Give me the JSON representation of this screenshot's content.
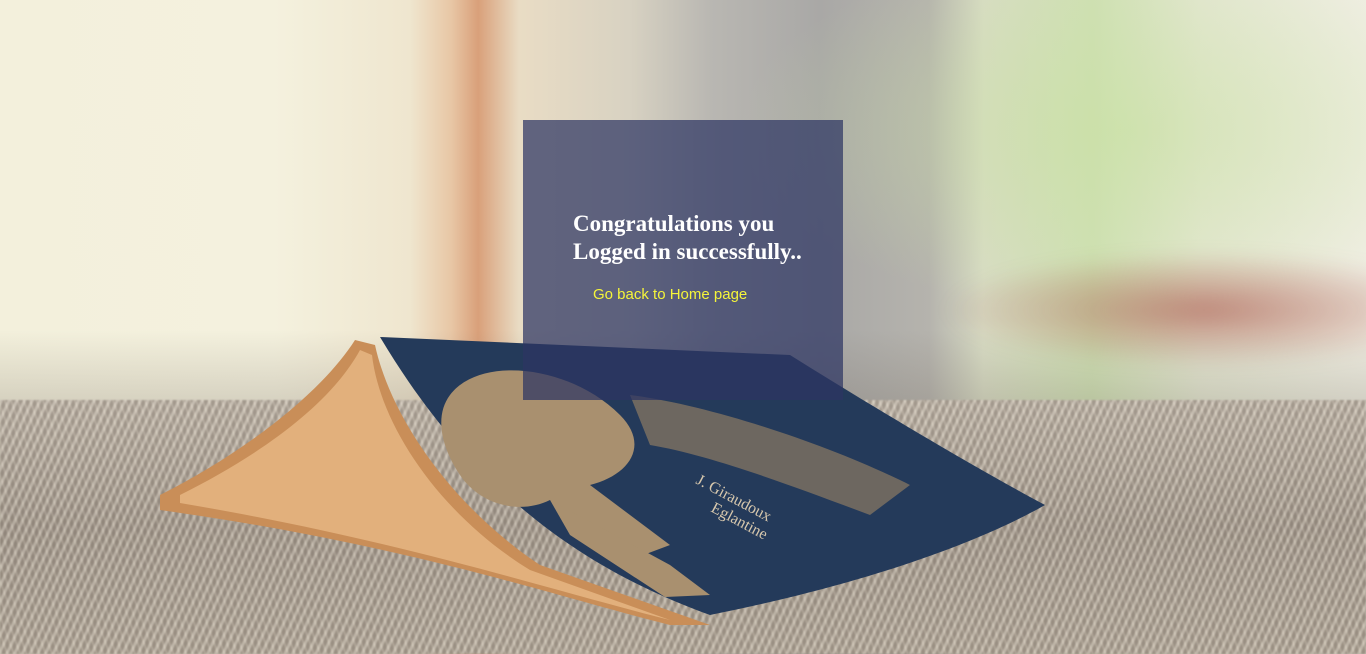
{
  "message": {
    "title": "Congratulations you Logged in successfully..",
    "link_label": "Go back to Home page"
  },
  "background": {
    "book_cover_text_line1": "J. Giraudoux",
    "book_cover_text_line2": "Eglantine"
  },
  "colors": {
    "card_bg": "#2c3462",
    "title_text": "#ffffff",
    "link_text": "#f5f53a"
  }
}
